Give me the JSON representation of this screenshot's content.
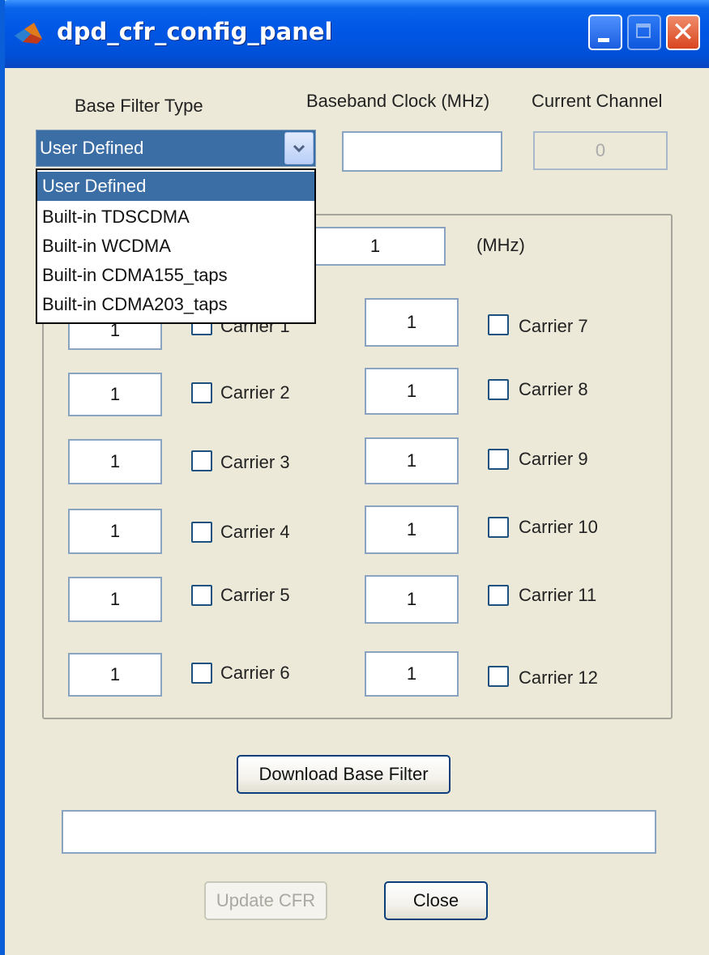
{
  "window": {
    "title": "dpd_cfr_config_panel",
    "controls": {
      "minimize": "minimize-icon",
      "maximize": "maximize-icon",
      "close": "close-icon"
    }
  },
  "base_filter": {
    "label": "Base Filter Type",
    "selected": "User Defined",
    "options": [
      "User Defined",
      "Built-in TDSCDMA",
      "Built-in WCDMA",
      "Built-in CDMA155_taps",
      "Built-in CDMA203_taps"
    ]
  },
  "baseband_clock": {
    "label": "Baseband Clock (MHz)",
    "value": ""
  },
  "current_channel": {
    "label": "Current Channel",
    "value": "0"
  },
  "bandwidth": {
    "value": "1",
    "unit": "(MHz)"
  },
  "carriers": [
    {
      "label": "Carrier 1",
      "value": "1"
    },
    {
      "label": "Carrier 2",
      "value": "1"
    },
    {
      "label": "Carrier 3",
      "value": "1"
    },
    {
      "label": "Carrier 4",
      "value": "1"
    },
    {
      "label": "Carrier 5",
      "value": "1"
    },
    {
      "label": "Carrier 6",
      "value": "1"
    },
    {
      "label": "Carrier 7",
      "value": "1"
    },
    {
      "label": "Carrier 8",
      "value": "1"
    },
    {
      "label": "Carrier 9",
      "value": "1"
    },
    {
      "label": "Carrier 10",
      "value": "1"
    },
    {
      "label": "Carrier 11",
      "value": "1"
    },
    {
      "label": "Carrier 12",
      "value": "1"
    }
  ],
  "download_button": "Download Base Filter",
  "status_field": "",
  "update_cfr_button": "Update CFR",
  "close_button": "Close",
  "colors": {
    "titlebar": "#0058e6",
    "selection": "#3a6ea5",
    "background": "#ece9d8"
  }
}
